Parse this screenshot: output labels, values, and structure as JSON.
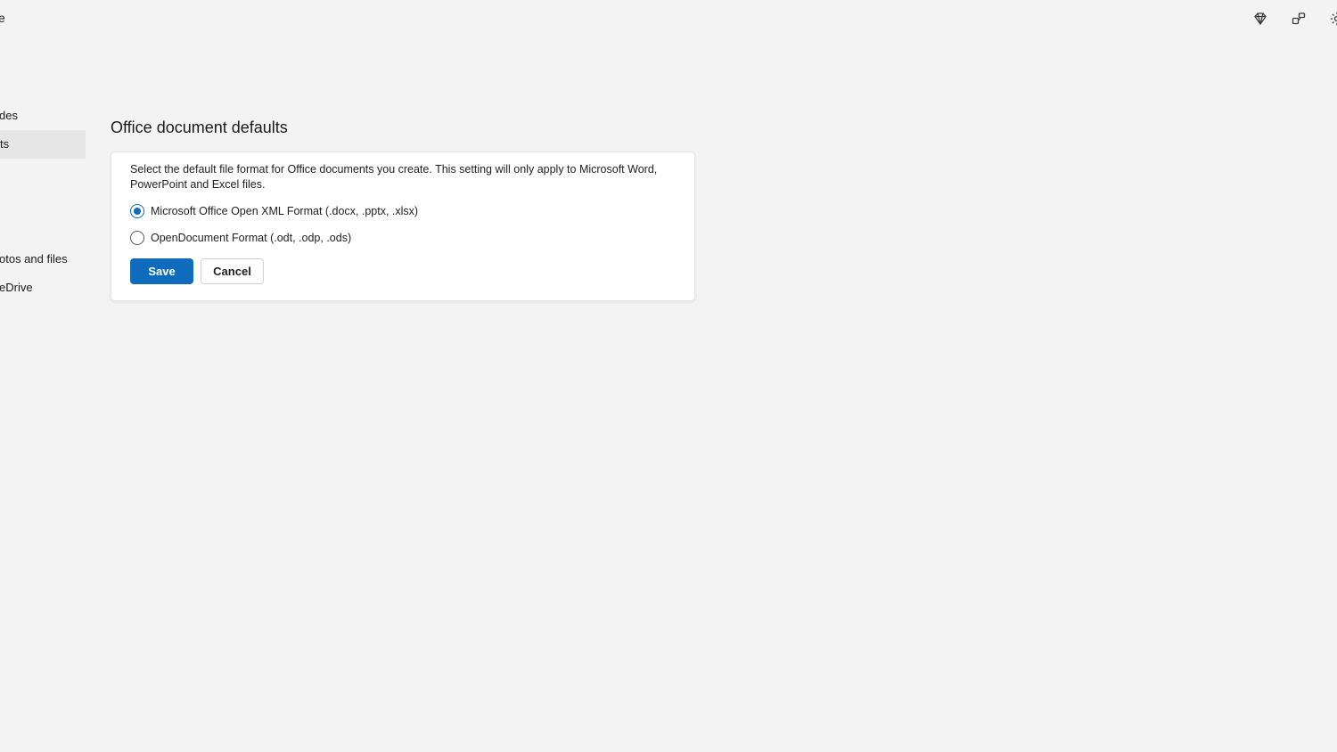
{
  "titlebar": {
    "left_fragment": "e"
  },
  "toolbar_icons": [
    "premium-diamond-icon",
    "share-apps-icon",
    "settings-gear-icon"
  ],
  "sidebar": {
    "items": [
      {
        "label": "des",
        "selected": false
      },
      {
        "label": "ts",
        "selected": true
      },
      {
        "label": "otos and files",
        "selected": false
      },
      {
        "label": "eDrive",
        "selected": false
      }
    ]
  },
  "main": {
    "heading": "Office document defaults",
    "description": "Select the default file format for Office documents you create. This setting will only apply to Microsoft Word, PowerPoint and Excel files.",
    "options": [
      {
        "label": "Microsoft Office Open XML Format (.docx, .pptx, .xlsx)",
        "checked": true
      },
      {
        "label": "OpenDocument Format (.odt, .odp, .ods)",
        "checked": false
      }
    ],
    "save_label": "Save",
    "cancel_label": "Cancel"
  },
  "colors": {
    "accent": "#0f6cbd",
    "background": "#f3f3f3",
    "card": "#ffffff",
    "sidebar_selected": "#e6e6e6"
  }
}
